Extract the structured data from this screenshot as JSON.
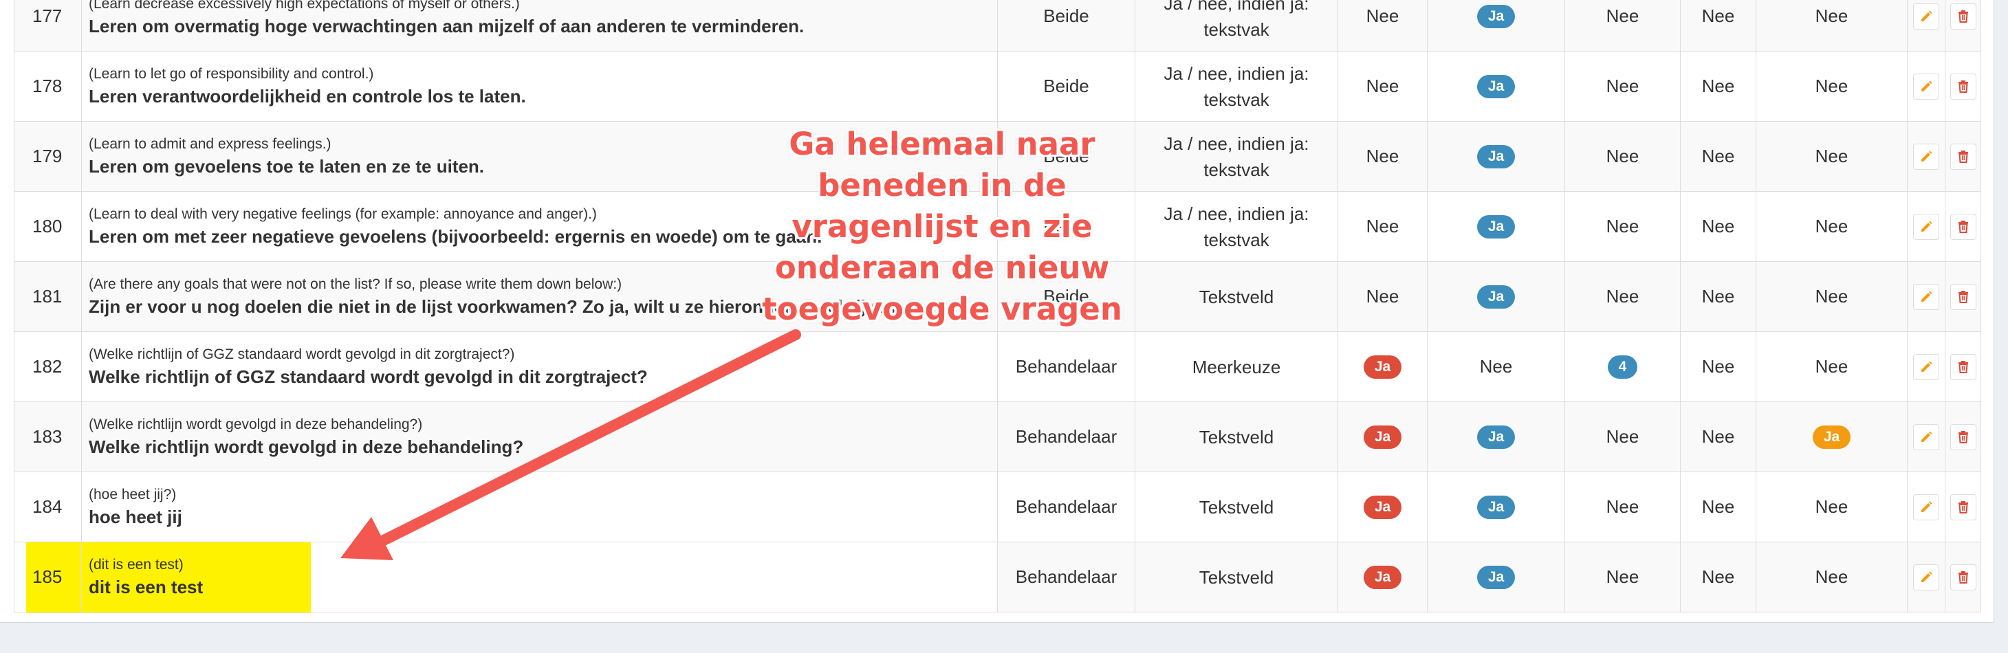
{
  "rows": [
    {
      "num": "177",
      "en": "(Learn decrease excessively high expectations of myself or others.)",
      "nl": "Leren om overmatig hoge verwachtingen aan mijzelf of aan anderen te verminderen.",
      "role": "Beide",
      "type": "Ja / nee, indien ja: tekstvak",
      "c1": "Nee",
      "c2": "Ja",
      "c3": "Nee",
      "c4": "Nee",
      "c5": "Nee"
    },
    {
      "num": "178",
      "en": "(Learn to let go of responsibility and control.)",
      "nl": "Leren verantwoordelijkheid en controle los te laten.",
      "role": "Beide",
      "type": "Ja / nee, indien ja: tekstvak",
      "c1": "Nee",
      "c2": "Ja",
      "c3": "Nee",
      "c4": "Nee",
      "c5": "Nee"
    },
    {
      "num": "179",
      "en": "(Learn to admit and express feelings.)",
      "nl": "Leren om gevoelens toe te laten en ze te uiten.",
      "role": "Beide",
      "type": "Ja / nee, indien ja: tekstvak",
      "c1": "Nee",
      "c2": "Ja",
      "c3": "Nee",
      "c4": "Nee",
      "c5": "Nee"
    },
    {
      "num": "180",
      "en": "(Learn to deal with very negative feelings (for example: annoyance and anger).)",
      "nl": "Leren om met zeer negatieve gevoelens (bijvoorbeeld: ergernis en woede) om te gaan.",
      "role": "Beide",
      "type": "Ja / nee, indien ja: tekstvak",
      "c1": "Nee",
      "c2": "Ja",
      "c3": "Nee",
      "c4": "Nee",
      "c5": "Nee"
    },
    {
      "num": "181",
      "en": "(Are there any goals that were not on the list? If so, please write them down below:)",
      "nl": "Zijn er voor u nog doelen die niet in de lijst voorkwamen? Zo ja, wilt u ze hieronder opschrijven:",
      "role": "Beide",
      "type": "Tekstveld",
      "c1": "Nee",
      "c2": "Ja",
      "c3": "Nee",
      "c4": "Nee",
      "c5": "Nee"
    },
    {
      "num": "182",
      "en": "(Welke richtlijn of GGZ standaard wordt gevolgd in dit zorgtraject?)",
      "nl": "Welke richtlijn of GGZ standaard wordt gevolgd in dit zorgtraject?",
      "role": "Behandelaar",
      "type": "Meerkeuze",
      "c1": "Ja",
      "c2": "Nee",
      "c3": "4",
      "c4": "Nee",
      "c5": "Nee"
    },
    {
      "num": "183",
      "en": "(Welke richtlijn wordt gevolgd in deze behandeling?)",
      "nl": "Welke richtlijn wordt gevolgd in deze behandeling?",
      "role": "Behandelaar",
      "type": "Tekstveld",
      "c1": "Ja",
      "c2": "Ja",
      "c3": "Nee",
      "c4": "Nee",
      "c5": "Ja"
    },
    {
      "num": "184",
      "en": "(hoe heet jij?)",
      "nl": "hoe heet jij",
      "role": "Behandelaar",
      "type": "Tekstveld",
      "c1": "Ja",
      "c2": "Ja",
      "c3": "Nee",
      "c4": "Nee",
      "c5": "Nee"
    },
    {
      "num": "185",
      "en": "(dit is een test)",
      "nl": "dit is een test",
      "role": "Behandelaar",
      "type": "Tekstveld",
      "c1": "Ja",
      "c2": "Ja",
      "c3": "Nee",
      "c4": "Nee",
      "c5": "Nee"
    }
  ],
  "annotation": {
    "text": "Ga helemaal naar beneden in de vragenlijst en zie onderaan de nieuw toegevoegde vragen",
    "color": "#f2584f"
  },
  "colors": {
    "badge_red": "#dd4b39",
    "badge_blue": "#3c8dbc",
    "badge_orange": "#f39c12",
    "highlight": "#fff200",
    "edit_icon": "#f39c12",
    "delete_icon": "#dd4b39"
  },
  "icons": {
    "edit": "pencil-icon",
    "delete": "trash-icon"
  }
}
